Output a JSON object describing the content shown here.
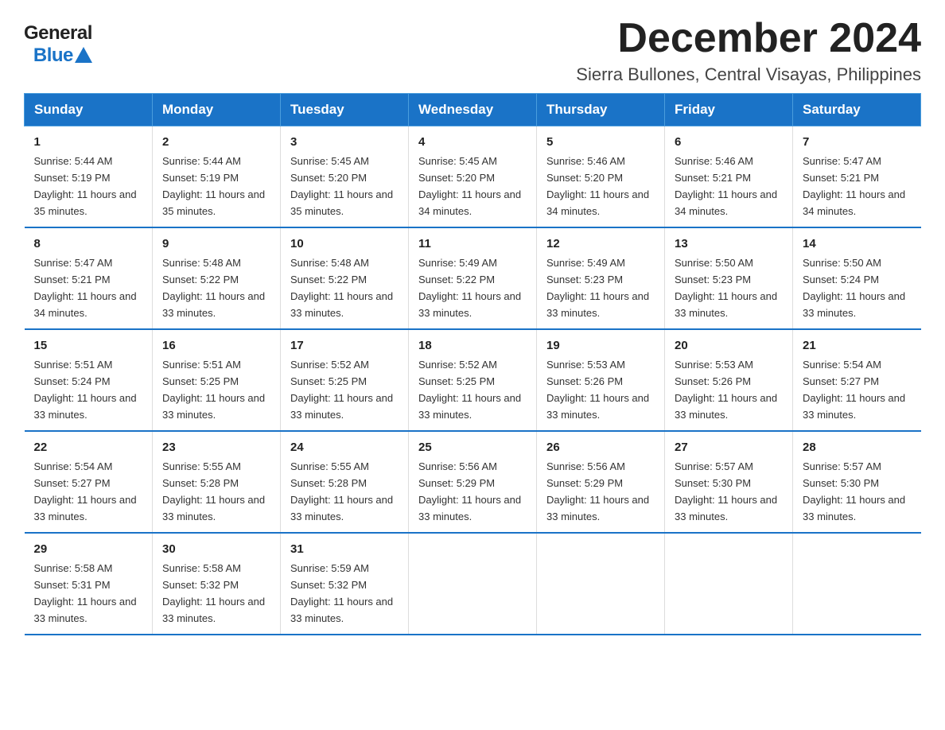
{
  "logo": {
    "text_general": "General",
    "text_blue": "Blue"
  },
  "header": {
    "month_year": "December 2024",
    "location": "Sierra Bullones, Central Visayas, Philippines"
  },
  "weekdays": [
    "Sunday",
    "Monday",
    "Tuesday",
    "Wednesday",
    "Thursday",
    "Friday",
    "Saturday"
  ],
  "weeks": [
    [
      {
        "day": "1",
        "sunrise": "5:44 AM",
        "sunset": "5:19 PM",
        "daylight": "11 hours and 35 minutes."
      },
      {
        "day": "2",
        "sunrise": "5:44 AM",
        "sunset": "5:19 PM",
        "daylight": "11 hours and 35 minutes."
      },
      {
        "day": "3",
        "sunrise": "5:45 AM",
        "sunset": "5:20 PM",
        "daylight": "11 hours and 35 minutes."
      },
      {
        "day": "4",
        "sunrise": "5:45 AM",
        "sunset": "5:20 PM",
        "daylight": "11 hours and 34 minutes."
      },
      {
        "day": "5",
        "sunrise": "5:46 AM",
        "sunset": "5:20 PM",
        "daylight": "11 hours and 34 minutes."
      },
      {
        "day": "6",
        "sunrise": "5:46 AM",
        "sunset": "5:21 PM",
        "daylight": "11 hours and 34 minutes."
      },
      {
        "day": "7",
        "sunrise": "5:47 AM",
        "sunset": "5:21 PM",
        "daylight": "11 hours and 34 minutes."
      }
    ],
    [
      {
        "day": "8",
        "sunrise": "5:47 AM",
        "sunset": "5:21 PM",
        "daylight": "11 hours and 34 minutes."
      },
      {
        "day": "9",
        "sunrise": "5:48 AM",
        "sunset": "5:22 PM",
        "daylight": "11 hours and 33 minutes."
      },
      {
        "day": "10",
        "sunrise": "5:48 AM",
        "sunset": "5:22 PM",
        "daylight": "11 hours and 33 minutes."
      },
      {
        "day": "11",
        "sunrise": "5:49 AM",
        "sunset": "5:22 PM",
        "daylight": "11 hours and 33 minutes."
      },
      {
        "day": "12",
        "sunrise": "5:49 AM",
        "sunset": "5:23 PM",
        "daylight": "11 hours and 33 minutes."
      },
      {
        "day": "13",
        "sunrise": "5:50 AM",
        "sunset": "5:23 PM",
        "daylight": "11 hours and 33 minutes."
      },
      {
        "day": "14",
        "sunrise": "5:50 AM",
        "sunset": "5:24 PM",
        "daylight": "11 hours and 33 minutes."
      }
    ],
    [
      {
        "day": "15",
        "sunrise": "5:51 AM",
        "sunset": "5:24 PM",
        "daylight": "11 hours and 33 minutes."
      },
      {
        "day": "16",
        "sunrise": "5:51 AM",
        "sunset": "5:25 PM",
        "daylight": "11 hours and 33 minutes."
      },
      {
        "day": "17",
        "sunrise": "5:52 AM",
        "sunset": "5:25 PM",
        "daylight": "11 hours and 33 minutes."
      },
      {
        "day": "18",
        "sunrise": "5:52 AM",
        "sunset": "5:25 PM",
        "daylight": "11 hours and 33 minutes."
      },
      {
        "day": "19",
        "sunrise": "5:53 AM",
        "sunset": "5:26 PM",
        "daylight": "11 hours and 33 minutes."
      },
      {
        "day": "20",
        "sunrise": "5:53 AM",
        "sunset": "5:26 PM",
        "daylight": "11 hours and 33 minutes."
      },
      {
        "day": "21",
        "sunrise": "5:54 AM",
        "sunset": "5:27 PM",
        "daylight": "11 hours and 33 minutes."
      }
    ],
    [
      {
        "day": "22",
        "sunrise": "5:54 AM",
        "sunset": "5:27 PM",
        "daylight": "11 hours and 33 minutes."
      },
      {
        "day": "23",
        "sunrise": "5:55 AM",
        "sunset": "5:28 PM",
        "daylight": "11 hours and 33 minutes."
      },
      {
        "day": "24",
        "sunrise": "5:55 AM",
        "sunset": "5:28 PM",
        "daylight": "11 hours and 33 minutes."
      },
      {
        "day": "25",
        "sunrise": "5:56 AM",
        "sunset": "5:29 PM",
        "daylight": "11 hours and 33 minutes."
      },
      {
        "day": "26",
        "sunrise": "5:56 AM",
        "sunset": "5:29 PM",
        "daylight": "11 hours and 33 minutes."
      },
      {
        "day": "27",
        "sunrise": "5:57 AM",
        "sunset": "5:30 PM",
        "daylight": "11 hours and 33 minutes."
      },
      {
        "day": "28",
        "sunrise": "5:57 AM",
        "sunset": "5:30 PM",
        "daylight": "11 hours and 33 minutes."
      }
    ],
    [
      {
        "day": "29",
        "sunrise": "5:58 AM",
        "sunset": "5:31 PM",
        "daylight": "11 hours and 33 minutes."
      },
      {
        "day": "30",
        "sunrise": "5:58 AM",
        "sunset": "5:32 PM",
        "daylight": "11 hours and 33 minutes."
      },
      {
        "day": "31",
        "sunrise": "5:59 AM",
        "sunset": "5:32 PM",
        "daylight": "11 hours and 33 minutes."
      },
      null,
      null,
      null,
      null
    ]
  ]
}
